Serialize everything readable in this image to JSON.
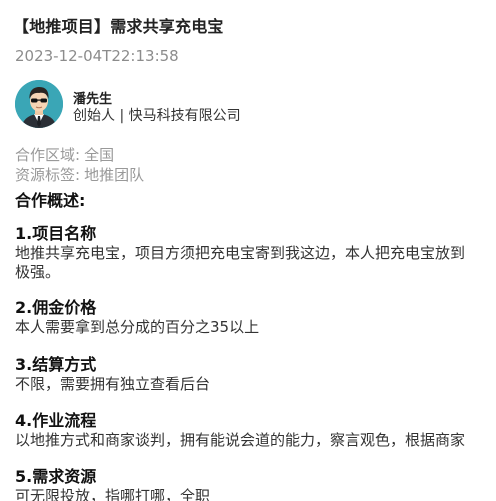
{
  "post": {
    "title": "【地推项目】需求共享充电宝",
    "timestamp": "2023-12-04T22:13:58"
  },
  "author": {
    "name": "潘先生",
    "role": "创始人 | 快马科技有限公司",
    "avatar_icon": "avatar-man-sunglasses-icon"
  },
  "meta": {
    "region_label": "合作区域:",
    "region_value": "全国",
    "tags_label": "资源标签:",
    "tags_value": "地推团队"
  },
  "overview": {
    "heading": "合作概述:",
    "sections": [
      {
        "heading": "1.项目名称",
        "lines": [
          "地推共享充电宝，项目方须把充电宝寄到我这边，本人把充电宝放到",
          "极强。"
        ]
      },
      {
        "heading": "2.佣金价格",
        "lines": [
          "本人需要拿到总分成的百分之35以上"
        ]
      },
      {
        "heading": "3.结算方式",
        "lines": [
          "不限，需要拥有独立查看后台"
        ]
      },
      {
        "heading": "4.作业流程",
        "lines": [
          "以地推方式和商家谈判，拥有能说会道的能力，察言观色，根据商家"
        ]
      },
      {
        "heading": "5.需求资源",
        "lines": [
          "可无限投放，指哪打哪，全职"
        ]
      }
    ]
  },
  "colors": {
    "title": "#222222",
    "muted": "#999999",
    "timestamp": "#8c8c8c",
    "avatar_bg": "#3aa6b6"
  }
}
